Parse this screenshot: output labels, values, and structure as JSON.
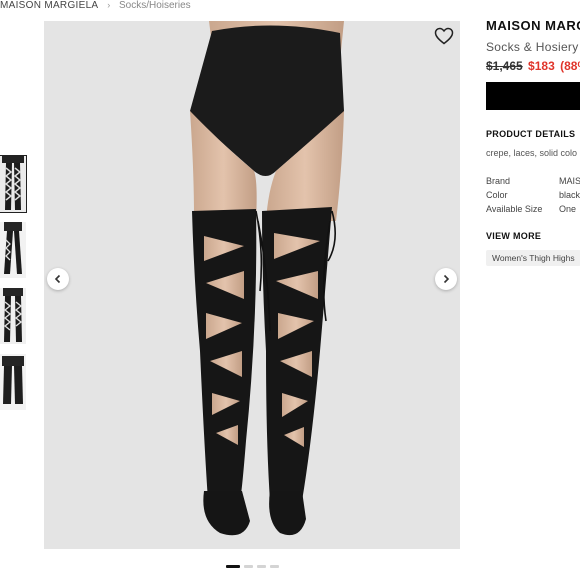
{
  "breadcrumb": {
    "brand": "MAISON MARGIELA",
    "category": "Socks/Hoiseries"
  },
  "product": {
    "brand": "MAISON MARG",
    "subtitle": "Socks & Hosiery",
    "original_price": "$1,465",
    "sale_price": "$183",
    "discount": "(88%"
  },
  "details": {
    "title": "PRODUCT DETAILS",
    "description": "crepe, laces, solid colo",
    "specs": [
      {
        "label": "Brand",
        "value": "MAIS"
      },
      {
        "label": "Color",
        "value": "black"
      },
      {
        "label": "Available Size",
        "value": "One"
      }
    ]
  },
  "view_more": {
    "title": "VIEW MORE",
    "tags": [
      "Women's Thigh Highs"
    ]
  },
  "gallery": {
    "thumbnail_count": 4,
    "active_index": 0,
    "dot_count": 4
  },
  "icons": {
    "favorite": "heart-icon",
    "prev": "chevron-left-icon",
    "next": "chevron-right-icon"
  },
  "colors": {
    "sale": "#e0352b",
    "cta": "#000000",
    "background": "#ffffff"
  }
}
